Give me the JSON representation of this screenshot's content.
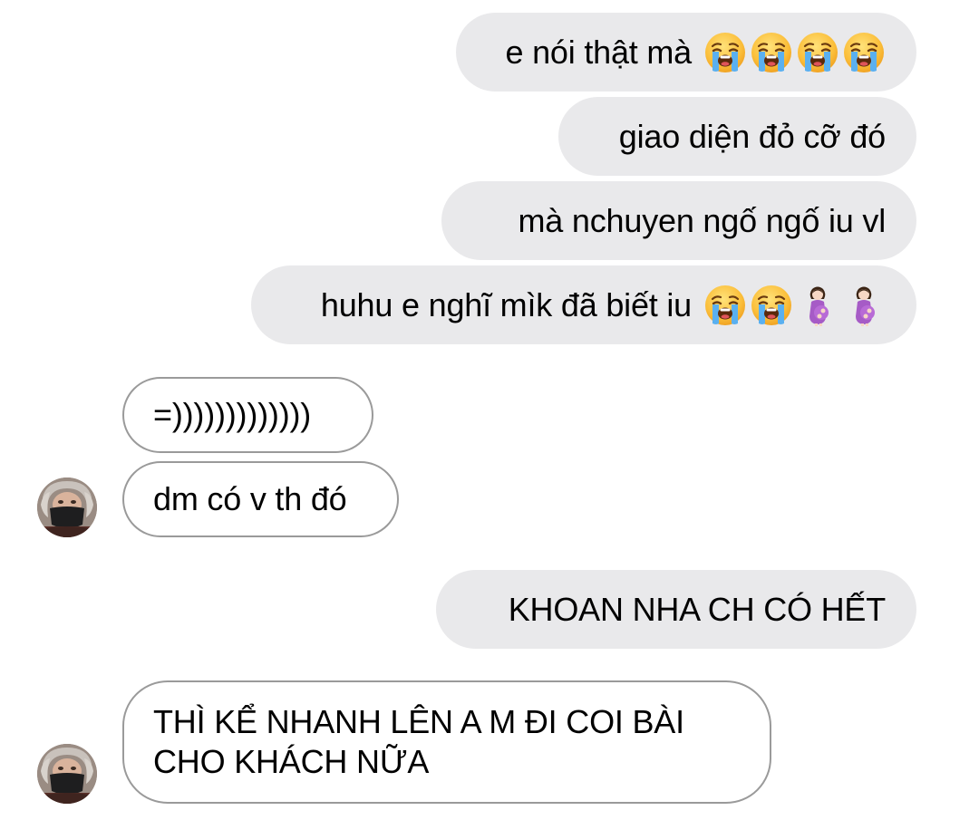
{
  "messages": {
    "m1": {
      "text": "e nói thật mà",
      "emojis": [
        "loudly-crying-face",
        "loudly-crying-face",
        "loudly-crying-face",
        "loudly-crying-face"
      ]
    },
    "m2": {
      "text": "giao diện đỏ cỡ đó"
    },
    "m3": {
      "text": "mà nchuyen ngố ngố iu vl"
    },
    "m4": {
      "text": "huhu e nghĩ mìk đã biết iu",
      "emojis": [
        "loudly-crying-face",
        "loudly-crying-face",
        "pregnant-woman",
        "pregnant-woman"
      ]
    },
    "m5": {
      "text": "=)))))))))))))"
    },
    "m6": {
      "text": "dm có v th đó"
    },
    "m7": {
      "text": "KHOAN NHA CH CÓ HẾT"
    },
    "m8": {
      "line1": "THÌ KỂ NHANH LÊN A M ĐI COI BÀI",
      "line2": "CHO KHÁCH NỮA"
    }
  },
  "colors": {
    "sent_bubble": "#e9e9eb",
    "received_border": "#9a9a9a",
    "text": "#000000"
  },
  "icons": {
    "avatar": "contact-avatar"
  }
}
